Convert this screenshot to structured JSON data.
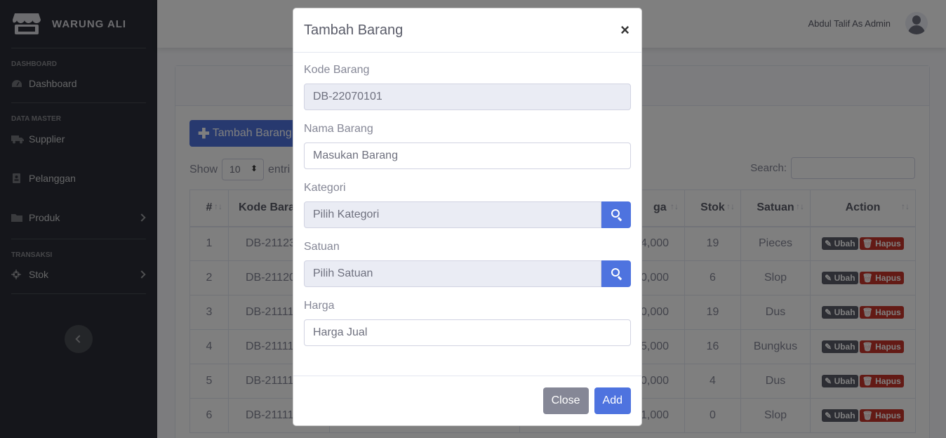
{
  "app": {
    "brand": "WARUNG ALI"
  },
  "sidebar": {
    "sections": [
      {
        "heading": "DASHBOARD"
      },
      {
        "heading": "DATA MASTER"
      },
      {
        "heading": "TRANSAKSI"
      }
    ],
    "items": [
      {
        "label": "Dashboard",
        "icon": "tachometer-icon"
      },
      {
        "label": "Supplier",
        "icon": "truck-icon"
      },
      {
        "label": "Pelanggan",
        "icon": "user-card-icon"
      },
      {
        "label": "Produk",
        "icon": "folder-icon"
      },
      {
        "label": "Stok",
        "icon": "gear-icon"
      }
    ]
  },
  "topbar": {
    "user_name": "Abdul Talif As Admin"
  },
  "page": {
    "add_button": "Tambah Barang",
    "show_label": "Show",
    "entries_label": "entri",
    "show_value": "10",
    "search_label": "Search:"
  },
  "table": {
    "columns": [
      "#",
      "Kode Bara",
      "",
      "ga",
      "Stok",
      "Satuan",
      "Action"
    ],
    "rows": [
      {
        "no": "1",
        "kode": "DB-21123",
        "harga": "4,000",
        "stok": "19",
        "satuan": "Pieces"
      },
      {
        "no": "2",
        "kode": "DB-21120",
        "harga": "0,000",
        "stok": "6",
        "satuan": "Slop"
      },
      {
        "no": "3",
        "kode": "DB-21111",
        "harga": "0,000",
        "stok": "19",
        "satuan": "Dus"
      },
      {
        "no": "4",
        "kode": "DB-21111",
        "harga": "5,000",
        "stok": "16",
        "satuan": "Bungkus"
      },
      {
        "no": "5",
        "kode": "DB-21111",
        "harga": "0,000",
        "stok": "4",
        "satuan": "Dus"
      },
      {
        "no": "6",
        "kode": "DB-21111",
        "harga": "1,000",
        "stok": "0",
        "satuan": "Slop"
      }
    ],
    "edit_label": "Ubah",
    "delete_label": "Hapus"
  },
  "modal": {
    "title": "Tambah Barang",
    "close_symbol": "×",
    "kode_label": "Kode Barang",
    "kode_value": "DB-22070101",
    "nama_label": "Nama Barang",
    "nama_placeholder": "Masukan Barang",
    "kategori_label": "Kategori",
    "kategori_placeholder": "Pilih Kategori",
    "satuan_label": "Satuan",
    "satuan_placeholder": "Pilih Satuan",
    "harga_label": "Harga",
    "harga_placeholder": "Harga Jual",
    "close_button": "Close",
    "add_button": "Add"
  },
  "colors": {
    "primary": "#4e73df",
    "sidebar": "#2a2d36",
    "danger": "#c6352a",
    "secondary": "#858796"
  }
}
